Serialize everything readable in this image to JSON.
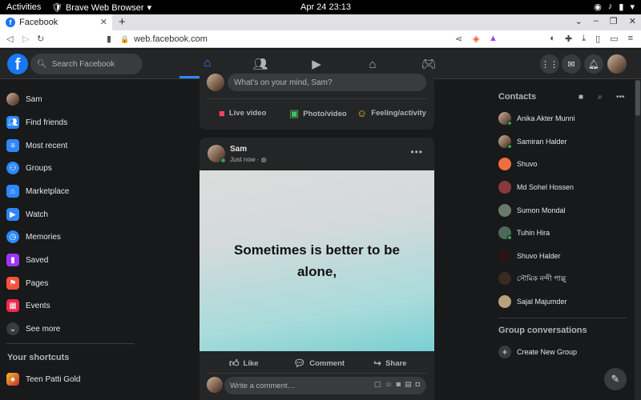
{
  "os": {
    "activities": "Activities",
    "app_name": "Brave Web Browser",
    "clock": "Apr 24  23:13"
  },
  "browser": {
    "tab_title": "Facebook",
    "new_tab": "+",
    "url": "web.facebook.com"
  },
  "header": {
    "logo": "f",
    "search_placeholder": "Search Facebook",
    "nav_tabs": [
      {
        "name": "home",
        "icon": "home-icon"
      },
      {
        "name": "friends",
        "icon": "friends-icon"
      },
      {
        "name": "watch",
        "icon": "watch-icon"
      },
      {
        "name": "marketplace",
        "icon": "marketplace-icon"
      },
      {
        "name": "gaming",
        "icon": "gaming-icon"
      }
    ]
  },
  "sidebar": {
    "items": [
      {
        "label": "Sam",
        "icon": "avatar"
      },
      {
        "label": "Find friends",
        "icon": "friends-icon"
      },
      {
        "label": "Most recent",
        "icon": "feed-icon"
      },
      {
        "label": "Groups",
        "icon": "groups-icon"
      },
      {
        "label": "Marketplace",
        "icon": "marketplace-icon"
      },
      {
        "label": "Watch",
        "icon": "watch-icon"
      },
      {
        "label": "Memories",
        "icon": "clock-icon"
      },
      {
        "label": "Saved",
        "icon": "bookmark-icon"
      },
      {
        "label": "Pages",
        "icon": "flag-icon"
      },
      {
        "label": "Events",
        "icon": "calendar-icon"
      },
      {
        "label": "See more",
        "icon": "chevron-down-icon"
      }
    ],
    "shortcuts_title": "Your shortcuts",
    "shortcuts": [
      {
        "label": "Teen Patti Gold",
        "icon": "game-icon"
      }
    ]
  },
  "composer": {
    "placeholder": "What's on your mind, Sam?",
    "actions": [
      {
        "label": "Live video",
        "icon": "live-video-icon",
        "color": "#f3425f"
      },
      {
        "label": "Photo/video",
        "icon": "photo-icon",
        "color": "#45bd62"
      },
      {
        "label": "Feeling/activity",
        "icon": "feeling-icon",
        "color": "#f7b928"
      }
    ]
  },
  "post": {
    "author": "Sam",
    "time": "Just now ·",
    "text": "Sometimes is better to be alone,",
    "actions": [
      "Like",
      "Comment",
      "Share"
    ],
    "comment_placeholder": "Write a comment…"
  },
  "contacts": {
    "title": "Contacts",
    "list": [
      {
        "name": "Anika Akter Munni",
        "online": true
      },
      {
        "name": "Samiran Halder",
        "online": true
      },
      {
        "name": "Shuvo",
        "online": false
      },
      {
        "name": "Md Sohel Hossen",
        "online": false
      },
      {
        "name": "Sumon Mondal",
        "online": false
      },
      {
        "name": "Tuhin Hira",
        "online": true
      },
      {
        "name": "Shuvo Halder",
        "online": false
      },
      {
        "name": "সৌমিক নন্দী পাল্লু",
        "online": false
      },
      {
        "name": "Sajal Majumder",
        "online": false
      }
    ],
    "groups_title": "Group conversations",
    "new_group": "Create New Group"
  },
  "colors": {
    "accent": "#2d88ff",
    "bg": "#18191a",
    "surface": "#242526"
  }
}
